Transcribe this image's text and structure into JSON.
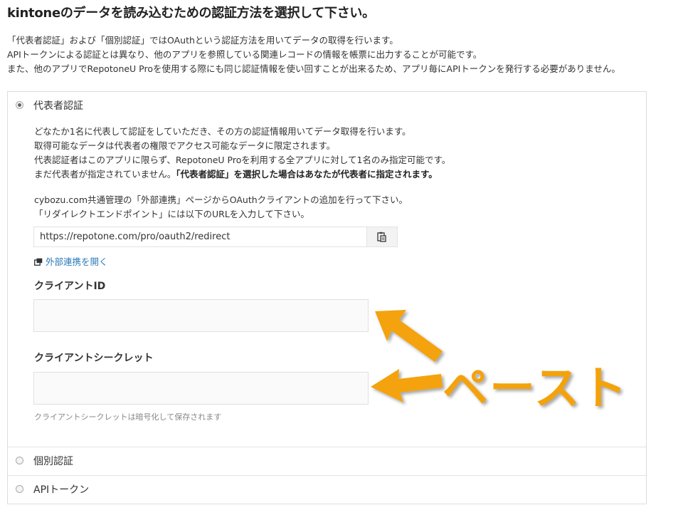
{
  "page": {
    "title": "kintoneのデータを読み込むための認証方法を選択して下さい。"
  },
  "intro": {
    "line1": "「代表者認証」および「個別認証」ではOAuthという認証方法を用いてデータの取得を行います。",
    "line2": "APIトークンによる認証とは異なり、他のアプリを参照している関連レコードの情報を帳票に出力することが可能です。",
    "line3": "また、他のアプリでRepotoneU Proを使用する際にも同じ認証情報を使い回すことが出来るため、アプリ毎にAPIトークンを発行する必要がありません。"
  },
  "auth_options": [
    {
      "label": "代表者認証",
      "selected": true
    },
    {
      "label": "個別認証",
      "selected": false
    },
    {
      "label": "APIトークン",
      "selected": false
    }
  ],
  "representative": {
    "desc1": "どなたか1名に代表して認証をしていただき、その方の認証情報用いてデータ取得を行います。",
    "desc2": "取得可能なデータは代表者の権限でアクセス可能なデータに限定されます。",
    "desc3": "代表認証者はこのアプリに限らず、RepotoneU Proを利用する全アプリに対して1名のみ指定可能です。",
    "desc4_plain": "まだ代表者が指定されていません。",
    "desc4_bold": "「代表者認証」を選択した場合はあなたが代表者に指定されます。",
    "setup1": "cybozu.com共通管理の「外部連携」ページからOAuthクライアントの追加を行って下さい。",
    "setup2": "「リダイレクトエンドポイント」には以下のURLを入力して下さい。",
    "redirect_url": "https://repotone.com/pro/oauth2/redirect",
    "copy_icon": "clipboard-icon",
    "open_link": "外部連携を開く",
    "open_link_icon": "external-window-icon",
    "client_id_label": "クライアントID",
    "client_id_value": "",
    "client_secret_label": "クライアントシークレット",
    "client_secret_value": "",
    "secret_hint": "クライアントシークレットは暗号化して保存されます"
  },
  "annotation": {
    "text": "ペースト",
    "color": "#f4a20c"
  }
}
